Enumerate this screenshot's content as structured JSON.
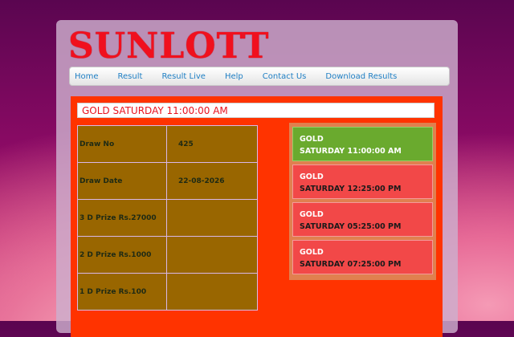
{
  "brand": {
    "logo_text": "SUNLOTT"
  },
  "nav": [
    "Home",
    "Result",
    "Result Live",
    "Help",
    "Contact Us",
    "Download Results"
  ],
  "panel_title": "GOLD SATURDAY 11:00:00 AM",
  "result_table": [
    {
      "label": "Draw No",
      "value": "425"
    },
    {
      "label": "Draw Date",
      "value": "22-08-2026"
    },
    {
      "label": "3 D Prize Rs.27000",
      "value": ""
    },
    {
      "label": "2 D Prize Rs.1000",
      "value": ""
    },
    {
      "label": "1 D Prize Rs.100",
      "value": ""
    }
  ],
  "draws": [
    {
      "name": "GOLD",
      "time": "SATURDAY 11:00:00 AM",
      "active": true
    },
    {
      "name": "GOLD",
      "time": "SATURDAY 12:25:00 PM",
      "active": false
    },
    {
      "name": "GOLD",
      "time": "SATURDAY 05:25:00 PM",
      "active": false
    },
    {
      "name": "GOLD",
      "time": "SATURDAY 07:25:00 PM",
      "active": false
    }
  ],
  "colors": {
    "logo": "#f0101e",
    "panel": "#ff3300",
    "cell": "#996600",
    "active_draw": "#6aaa2e",
    "draw": "#f24848",
    "nav_link": "#1f7fc4"
  }
}
